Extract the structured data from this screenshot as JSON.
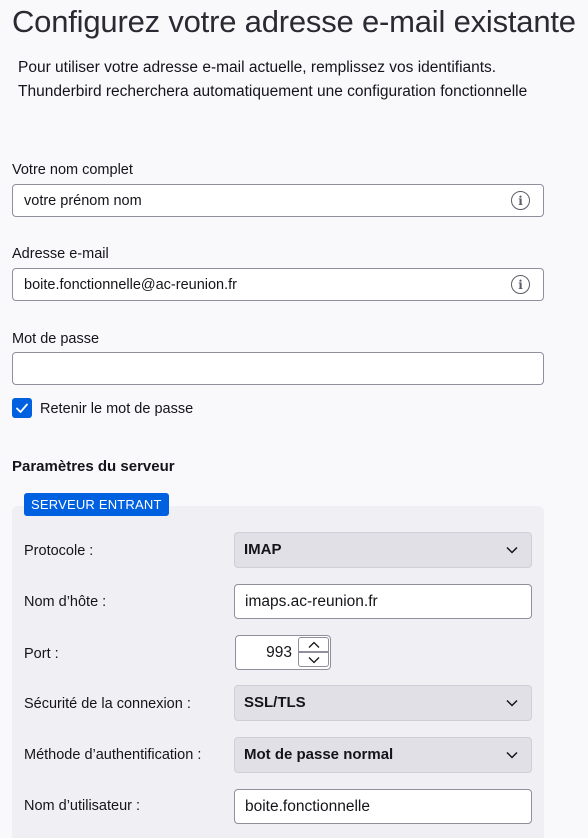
{
  "header": {
    "title": "Configurez votre adresse e-mail existante",
    "subtitle_line1": "Pour utiliser votre adresse e-mail actuelle, remplissez vos identifiants.",
    "subtitle_line2": "Thunderbird recherchera automatiquement une configuration fonctionnelle"
  },
  "form": {
    "full_name_label": "Votre nom complet",
    "full_name_value": "votre prénom nom",
    "email_label": "Adresse e-mail",
    "email_value": "boite.fonctionnelle@ac-reunion.fr",
    "password_label": "Mot de passe",
    "password_value": "",
    "remember_label": "Retenir le mot de passe",
    "remember_checked": true,
    "info_icon": "info-icon"
  },
  "server": {
    "section_title": "Paramètres du serveur",
    "incoming_badge": "SERVEUR ENTRANT",
    "protocol_label": "Protocole :",
    "protocol_value": "IMAP",
    "hostname_label": "Nom d’hôte :",
    "hostname_value": "imaps.ac-reunion.fr",
    "port_label": "Port :",
    "port_value": "993",
    "security_label": "Sécurité de la connexion :",
    "security_value": "SSL/TLS",
    "auth_label": "Méthode d’authentification :",
    "auth_value": "Mot de passe normal",
    "username_label": "Nom d’utilisateur :",
    "username_value": "boite.fonctionnelle"
  },
  "colors": {
    "accent": "#0061e0",
    "panel": "#f0f0f4",
    "background": "#f9f9fb"
  }
}
